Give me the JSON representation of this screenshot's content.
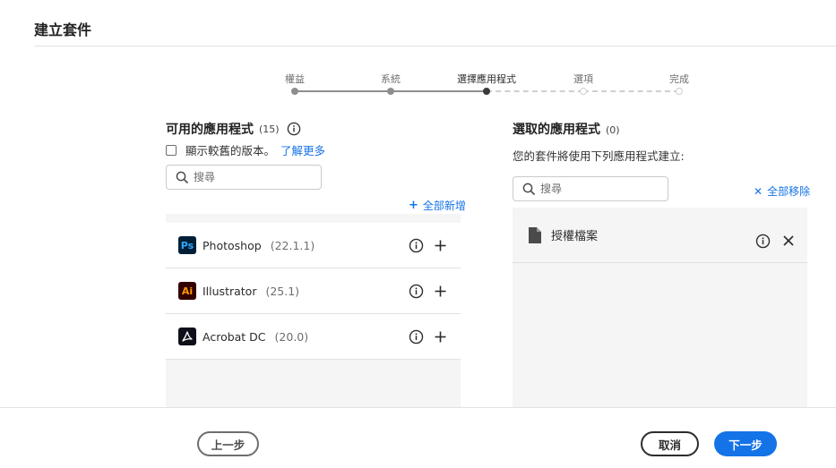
{
  "header": {
    "title": "建立套件"
  },
  "stepper": {
    "steps": [
      {
        "label": "權益",
        "state": "done"
      },
      {
        "label": "系統",
        "state": "done"
      },
      {
        "label": "選擇應用程式",
        "state": "current"
      },
      {
        "label": "選項",
        "state": "todo"
      },
      {
        "label": "完成",
        "state": "todo"
      }
    ]
  },
  "available": {
    "title": "可用的應用程式",
    "count": "(15)",
    "show_older_label": "顯示較舊的版本。",
    "learn_more": "了解更多",
    "search_placeholder": "搜尋",
    "add_all": "全部新增",
    "apps": [
      {
        "icon": "photoshop-icon",
        "icon_text": "Ps",
        "name": "Photoshop",
        "version": "(22.1.1)"
      },
      {
        "icon": "illustrator-icon",
        "icon_text": "Ai",
        "name": "Illustrator",
        "version": "(25.1)"
      },
      {
        "icon": "acrobat-icon",
        "icon_text": "",
        "name": "Acrobat DC",
        "version": "(20.0)"
      }
    ]
  },
  "selected": {
    "title": "選取的應用程式",
    "count": "(0)",
    "description": "您的套件將使用下列應用程式建立:",
    "search_placeholder": "搜尋",
    "remove_all": "全部移除",
    "items": [
      {
        "icon": "document-icon",
        "label": "授權檔案"
      }
    ]
  },
  "footer": {
    "back_label": "上一步",
    "cancel_label": "取消",
    "next_label": "下一步"
  },
  "colors": {
    "accent": "#1473e6",
    "panel_bg": "#f5f5f5",
    "photoshop": "#31a8ff",
    "illustrator": "#ff9a00"
  }
}
